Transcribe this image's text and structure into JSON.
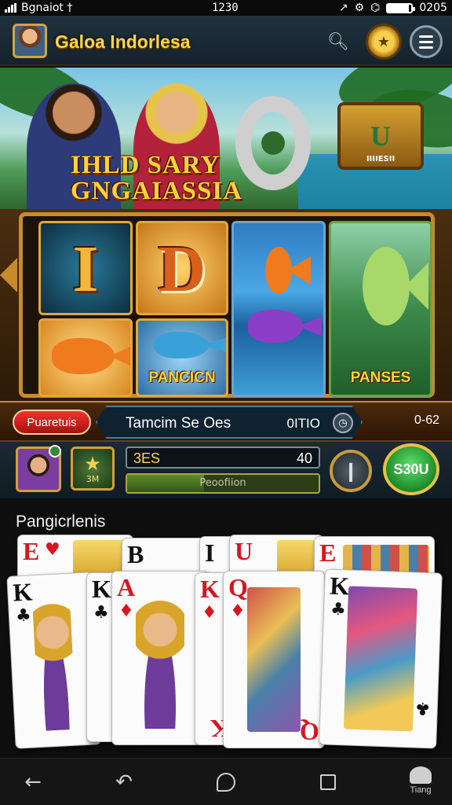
{
  "status_bar": {
    "carrier": "Bgnaiot †",
    "time": "1230",
    "right_text": "0205",
    "battery_level": 0.9
  },
  "header": {
    "title": "Galoa Indorlesa",
    "icons": [
      "avatar",
      "search-icon",
      "trophy-icon",
      "menu-icon"
    ]
  },
  "banner": {
    "title_line1": "IHLD SARY",
    "title_line2": "GNGAIASSIA",
    "chest_letter": "U",
    "chest_label": "IIIIESII"
  },
  "reels": {
    "tile_1_letter": "I",
    "tile_2_letter": "D",
    "tile_fish_label": "PANCICN",
    "tile_jungle_label": "PANSES"
  },
  "info_bar": {
    "left_pill": "Puaretuis",
    "center_text": "Tamcim Se Oes",
    "center_value": "0ITIO",
    "right_value": "0-62"
  },
  "controls": {
    "star_tile_value": "3M",
    "bet_label": "3ES",
    "bet_value": "40",
    "bet_bar_text": "Peoofiion",
    "bet_bar_level": 0.4,
    "spin_label": "S30U"
  },
  "cards": {
    "section_title": "Pangicrlenis",
    "back_row": [
      {
        "rank": "E",
        "suit": "♥",
        "color": "red"
      },
      {
        "rank": "B",
        "suit": "",
        "color": "blk"
      },
      {
        "rank": "I",
        "suit": "",
        "color": "blk"
      },
      {
        "rank": "U",
        "suit": "",
        "color": "red"
      },
      {
        "rank": "E",
        "suit": "",
        "color": "red"
      }
    ],
    "front_row": [
      {
        "rank": "K",
        "suit": "♣",
        "color": "blk"
      },
      {
        "rank": "K",
        "suit": "♣",
        "color": "blk"
      },
      {
        "rank": "A",
        "suit": "♦",
        "color": "red"
      },
      {
        "rank": "K",
        "suit": "♦",
        "color": "red"
      },
      {
        "rank": "Q",
        "suit": "♦",
        "color": "red"
      },
      {
        "rank": "K",
        "suit": "♣",
        "color": "blk"
      }
    ]
  },
  "navbar": {
    "tiang_label": "Tiang"
  },
  "colors": {
    "gold": "#ffd44a",
    "frame": "#c88b2c",
    "spin_green": "#1c8a2a",
    "pill_red": "#d8161f"
  }
}
